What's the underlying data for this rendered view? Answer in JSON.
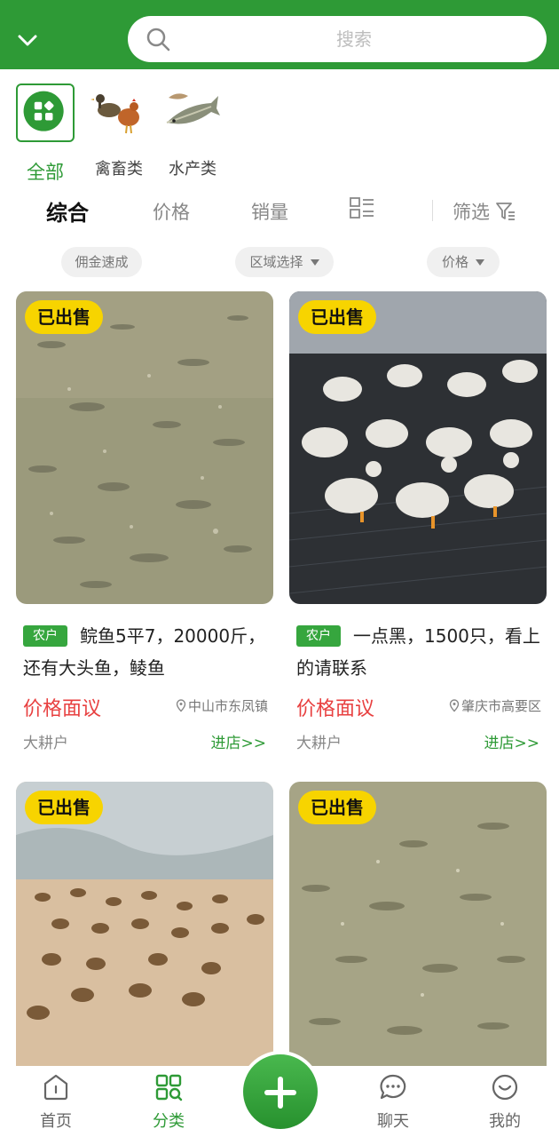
{
  "header": {
    "collapse_icon": "chevron-down-icon",
    "search_icon": "search-icon",
    "search_placeholder": "搜索"
  },
  "categories": [
    {
      "label": "全部",
      "icon": "grid-icon",
      "active": true
    },
    {
      "label": "禽畜类",
      "icon": "poultry-image"
    },
    {
      "label": "水产类",
      "icon": "fish-image"
    }
  ],
  "sort_tabs": {
    "comprehensive": "综合",
    "price": "价格",
    "sales": "销量",
    "layout_icon": "list-grid-toggle-icon",
    "filter": "筛选",
    "filter_icon": "filter-icon"
  },
  "chips": {
    "commission": "佣金速成",
    "region": "区域选择",
    "price": "价格"
  },
  "products": [
    {
      "badge": "已出售",
      "tag": "农户",
      "title": "鲩鱼5平7，20000斤，还有大头鱼，鲮鱼",
      "price": "价格面议",
      "location": "中山市东凤镇",
      "seller": "大耕户",
      "shop_link": "进店>>"
    },
    {
      "badge": "已出售",
      "tag": "农户",
      "title": "一点黑，1500只，看上的请联系",
      "price": "价格面议",
      "location": "肇庆市高要区",
      "seller": "大耕户",
      "shop_link": "进店>>"
    },
    {
      "badge": "已出售"
    },
    {
      "badge": "已出售"
    }
  ],
  "bottom_nav": {
    "home": "首页",
    "category": "分类",
    "chat": "聊天",
    "mine": "我的"
  },
  "colors": {
    "brand_green": "#2e9a36",
    "badge_yellow": "#f7d400",
    "price_red": "#e84040"
  }
}
